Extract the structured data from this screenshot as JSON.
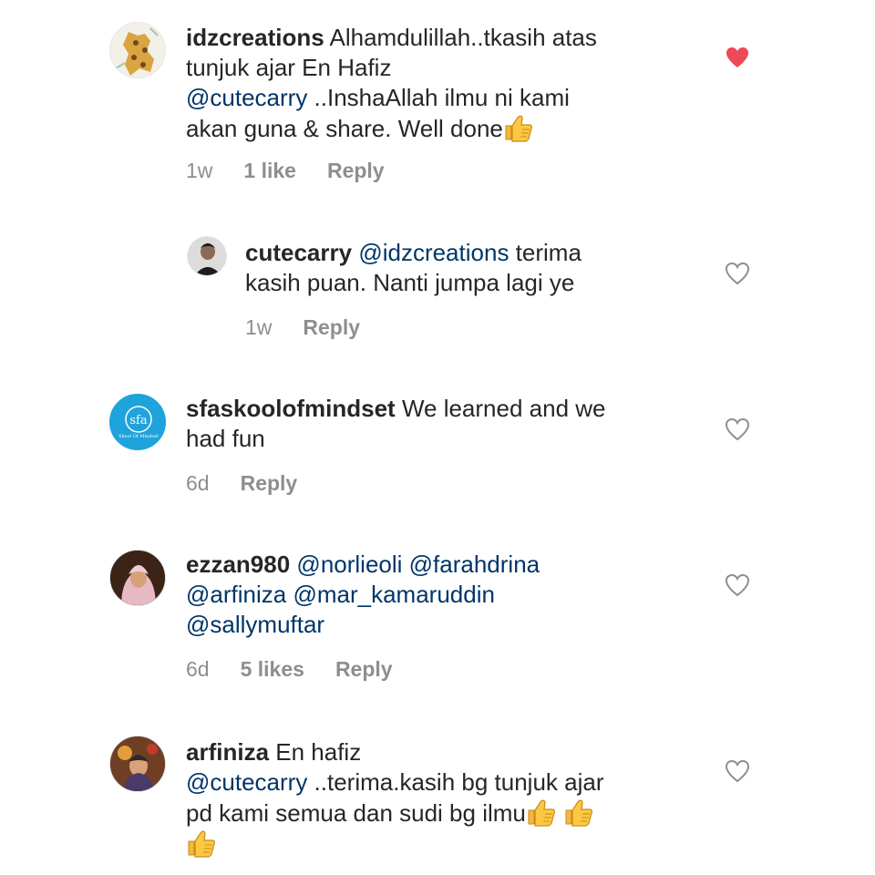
{
  "comments": [
    {
      "username": "idzcreations",
      "line1": "Alhamdulillah..tkasih atas",
      "line2": "tunjuk ajar En Hafiz",
      "mention": "@cutecarry",
      "line3": " ..InshaAllah ilmu ni kami",
      "line4": "akan guna & share. Well done",
      "time": "1w",
      "likes": "1 like",
      "reply": "Reply",
      "liked": true
    },
    {
      "username": "cutecarry",
      "mention": "@idzcreations",
      "line1": " terima",
      "line2": "kasih puan. Nanti jumpa lagi ye",
      "time": "1w",
      "reply": "Reply",
      "liked": false
    },
    {
      "username": "sfaskoolofmindset",
      "line1": " We learned and we",
      "line2": "had fun",
      "avatar_text": "sfa",
      "avatar_sub": "Skool Of Mindset",
      "time": "6d",
      "reply": "Reply",
      "liked": false
    },
    {
      "username": "ezzan980",
      "m1": "@norlieoli",
      "m2": "@farahdrina",
      "m3": "@arfiniza",
      "m4": "@mar_kamaruddin",
      "m5": "@sallymuftar",
      "time": "6d",
      "likes": "5 likes",
      "reply": "Reply",
      "liked": false
    },
    {
      "username": "arfiniza",
      "line1": " En hafiz",
      "mention": "@cutecarry",
      "line2": " ..terima.kasih bg tunjuk ajar",
      "line3": "pd kami semua dan sudi bg ilmu",
      "liked": false
    }
  ],
  "colors": {
    "mention": "#003569",
    "liked_heart": "#ed4956",
    "meta": "#8e8e8e",
    "sfa_brand": "#1fa3dc"
  },
  "icons": [
    "heart-icon",
    "thumbs-up-icon"
  ]
}
